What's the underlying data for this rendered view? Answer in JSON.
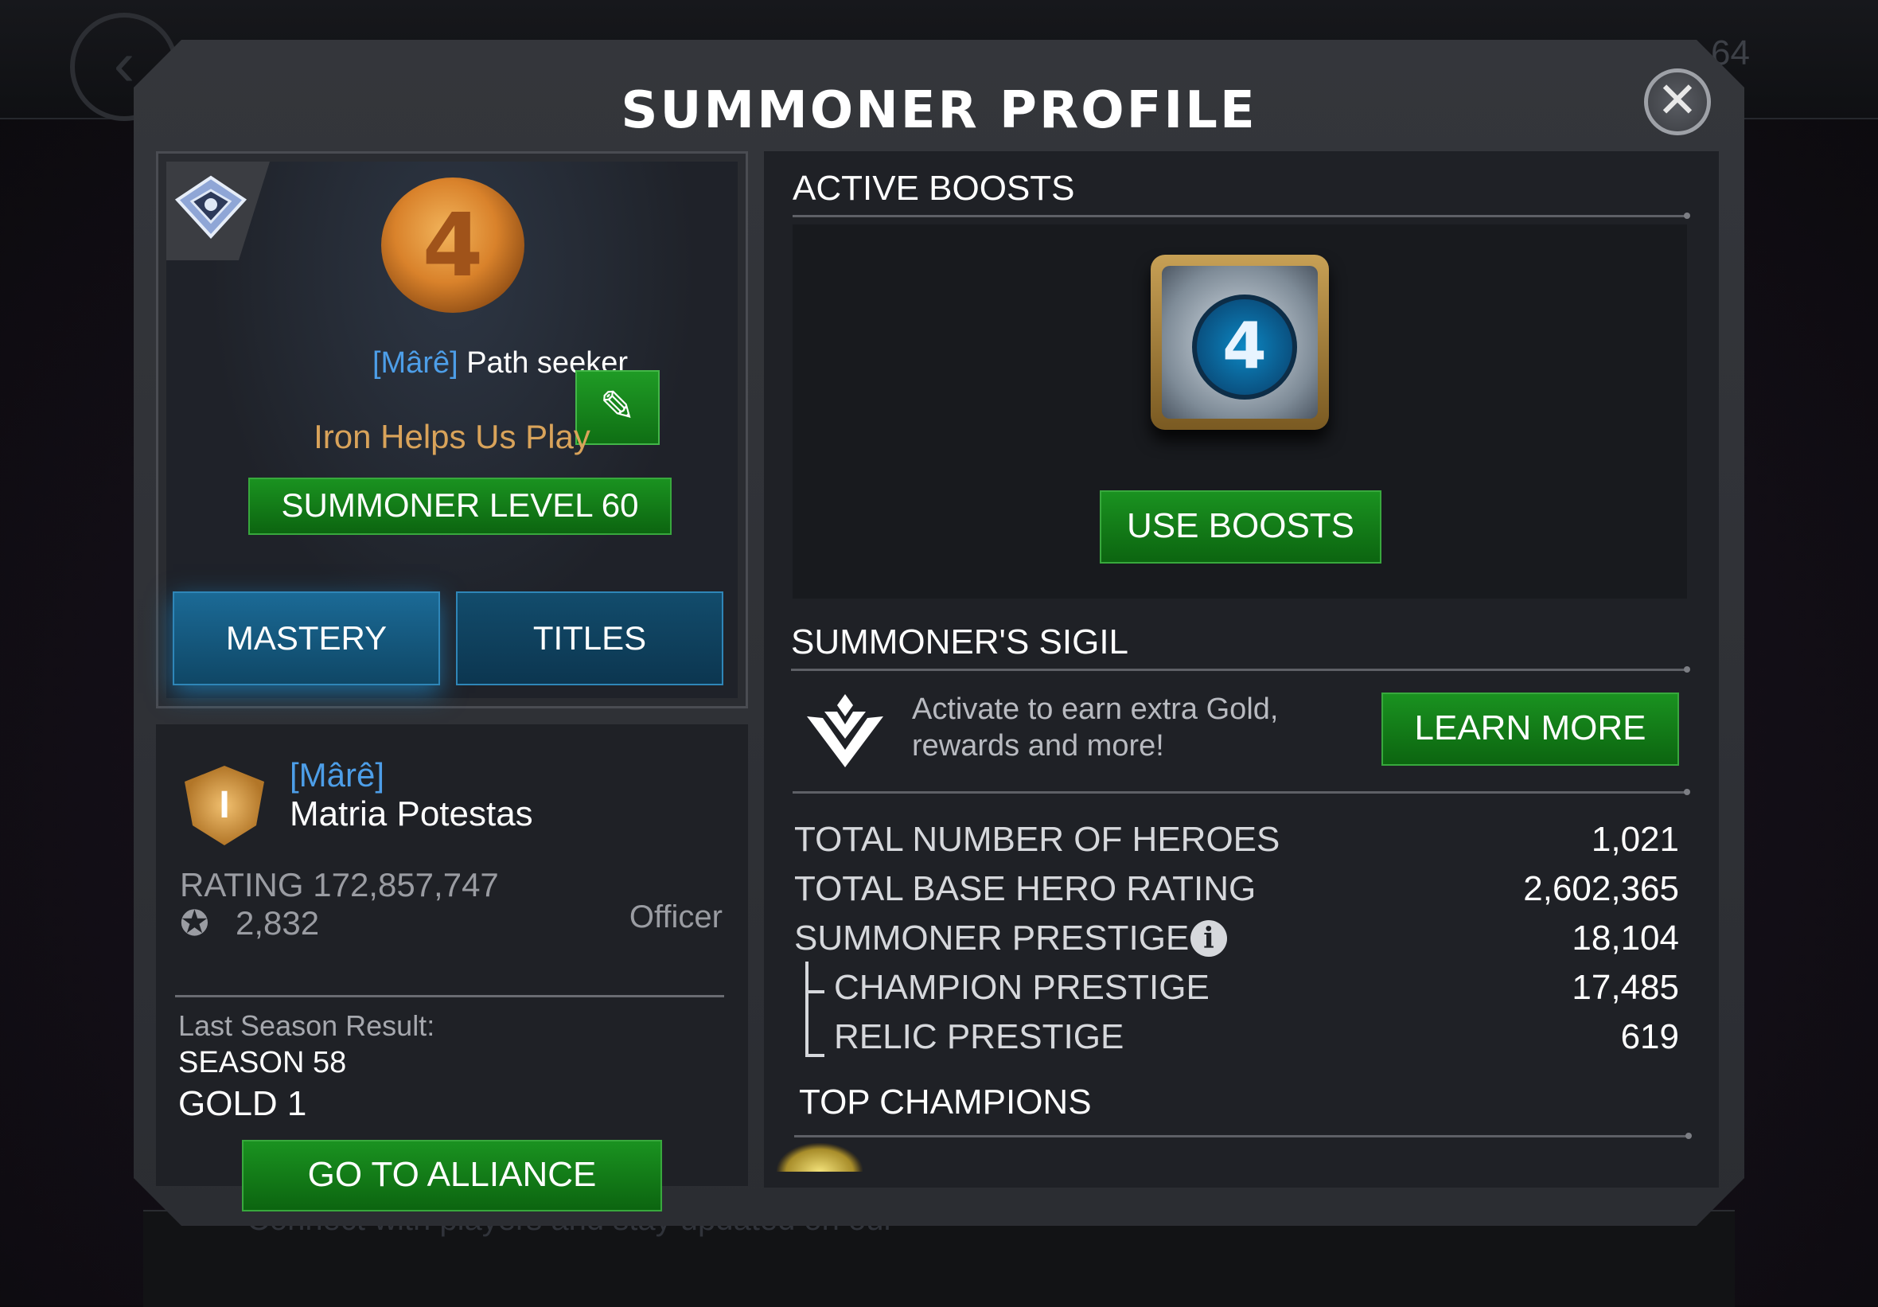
{
  "background": {
    "badge_number": "64",
    "bottom_text": "Connect with players and stay updated on our"
  },
  "modal": {
    "title": "SUMMONER PROFILE",
    "close_icon": "close-icon"
  },
  "profile": {
    "alliance_tag": "[Mârê]",
    "name": "Path seeker",
    "motto": "Iron Helps Us Play",
    "level_label": "SUMMONER LEVEL 60",
    "tabs": [
      {
        "label": "MASTERY"
      },
      {
        "label": "TITLES"
      }
    ]
  },
  "alliance": {
    "tag": "[Mârê]",
    "name": "Matria Potestas",
    "rating": "RATING 172,857,747",
    "trophies": "2,832",
    "role": "Officer",
    "last_season_label": "Last Season Result:",
    "season": "SEASON 58",
    "tier": "GOLD 1",
    "go_button": "GO TO ALLIANCE"
  },
  "boosts": {
    "title": "ACTIVE BOOSTS",
    "use_button": "USE BOOSTS"
  },
  "sigil": {
    "title": "SUMMONER'S SIGIL",
    "text_line1": "Activate to earn extra Gold,",
    "text_line2": "rewards and more!",
    "learn_button": "LEARN MORE"
  },
  "stats": {
    "heroes_label": "TOTAL NUMBER OF HEROES",
    "heroes_value": "1,021",
    "base_rating_label": "TOTAL BASE HERO RATING",
    "base_rating_value": "2,602,365",
    "prestige_label": "SUMMONER PRESTIGE",
    "prestige_value": "18,104",
    "champion_prestige_label": "CHAMPION PRESTIGE",
    "champion_prestige_value": "17,485",
    "relic_prestige_label": "RELIC PRESTIGE",
    "relic_prestige_value": "619"
  },
  "top_champions": {
    "title": "TOP CHAMPIONS"
  },
  "colors": {
    "green_button": "#1a9220",
    "blue_tab": "#1b6a96",
    "tag_blue": "#4d9ee8",
    "motto_gold": "#d9a35a"
  }
}
